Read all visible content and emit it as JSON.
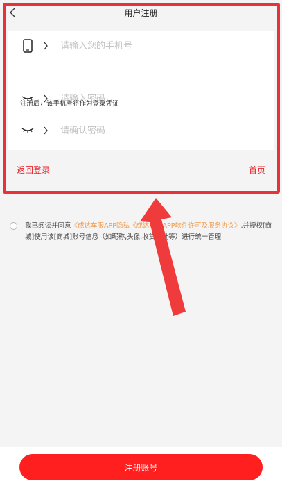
{
  "header": {
    "title": "用户注册"
  },
  "form": {
    "phone_placeholder": "请输入您的手机号",
    "hint": "注册后，该手机号将作为登录凭证",
    "password_placeholder": "请输入密码",
    "confirm_placeholder": "请确认密码"
  },
  "links": {
    "back_login": "返回登录",
    "home": "首页"
  },
  "agreement": {
    "prefix": "我已阅读并同意",
    "privacy": "《成达车服APP隐私",
    "license": "《成达车服APP软件许可及服务协议》",
    "mid": ",并授权[商城]使用该[商城]账号信息（如昵称,头像,收货地址等）进行统一管理"
  },
  "footer": {
    "register_label": "注册账号"
  },
  "colors": {
    "accent": "#ff1f1f",
    "link": "#e8272d",
    "agreement_link": "#f29a4a"
  }
}
